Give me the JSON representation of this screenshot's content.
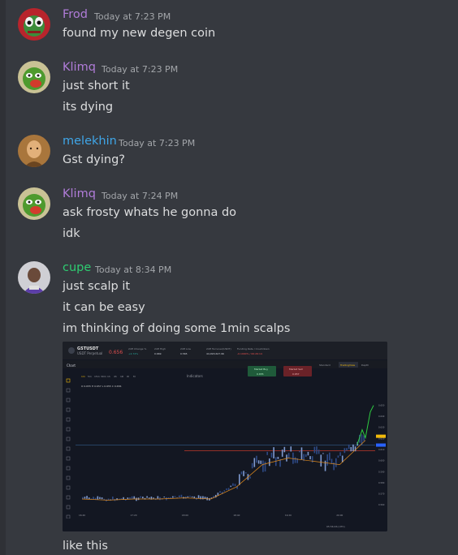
{
  "messages": [
    {
      "username": "Frod",
      "color": "#b07cd8",
      "timestamp": "Today at 7:23 PM",
      "lines": [
        "found my new degen coin"
      ],
      "avatar": "frog-avatar"
    },
    {
      "username": "Klimq",
      "color": "#b07cd8",
      "timestamp": "Today at 7:23 PM",
      "lines": [
        "just short it",
        "its dying"
      ],
      "avatar": "pepe-avatar"
    },
    {
      "username": "melekhin",
      "color": "#3fa6e8",
      "timestamp": "Today at 7:23 PM",
      "lines": [
        "Gst dying?"
      ],
      "avatar": "portrait-avatar"
    },
    {
      "username": "Klimq",
      "color": "#b07cd8",
      "timestamp": "Today at 7:24 PM",
      "lines": [
        "ask frosty whats he gonna do",
        "idk"
      ],
      "avatar": "pepe-avatar"
    },
    {
      "username": "cupe",
      "color": "#2ecc71",
      "timestamp": "Today at 8:34 PM",
      "lines": [
        "just scalp it",
        "it can be easy",
        "im thinking of doing some 1min scalps"
      ],
      "avatar": "character-avatar"
    }
  ],
  "embed": {
    "symbol": "GSTUSDT",
    "subtitle": "USDT Perpetual",
    "price": "0.656",
    "stats": [
      {
        "label": "24H Change %",
        "value": "+4.74%"
      },
      {
        "label": "24H High",
        "value": "0.669"
      },
      {
        "label": "24H Low",
        "value": "0.565"
      },
      {
        "label": "24H Turnover(USDT)",
        "value": "44,093,627.96"
      },
      {
        "label": "Funding Rate / Countdown",
        "value": "-0.1000% / 00:26:14"
      }
    ],
    "panel_label": "Chart",
    "view_tabs": [
      "Standard",
      "TradingView",
      "Depth"
    ],
    "timeframes": [
      "1m",
      "5m",
      "15m",
      "30m",
      "1h",
      "4h",
      "1D",
      "W",
      "M"
    ],
    "indicators_label": "Indicators",
    "market_buy": "Market Buy",
    "market_sell": "Market Sell",
    "buy_price": "0.655",
    "sell_price": "0.657",
    "ohlc": "O 0.655  H 0.657  L 0.655  C 0.656",
    "footer": "05:56:46 (UTC)",
    "chart_data": {
      "type": "candlestick",
      "x": [
        "16:40",
        "17:00",
        "17:20",
        "17:40",
        "18:00",
        "18:20",
        "18:40",
        "19:00",
        "19:20",
        "19:40",
        "20:00",
        "20:20"
      ],
      "ylim": [
        0.555,
        0.665
      ],
      "close": [
        0.566,
        0.565,
        0.566,
        0.566,
        0.567,
        0.566,
        0.58,
        0.6,
        0.606,
        0.603,
        0.6,
        0.622
      ],
      "support_line": 0.609,
      "blue_line": 0.614
    }
  },
  "final_line": "like this"
}
